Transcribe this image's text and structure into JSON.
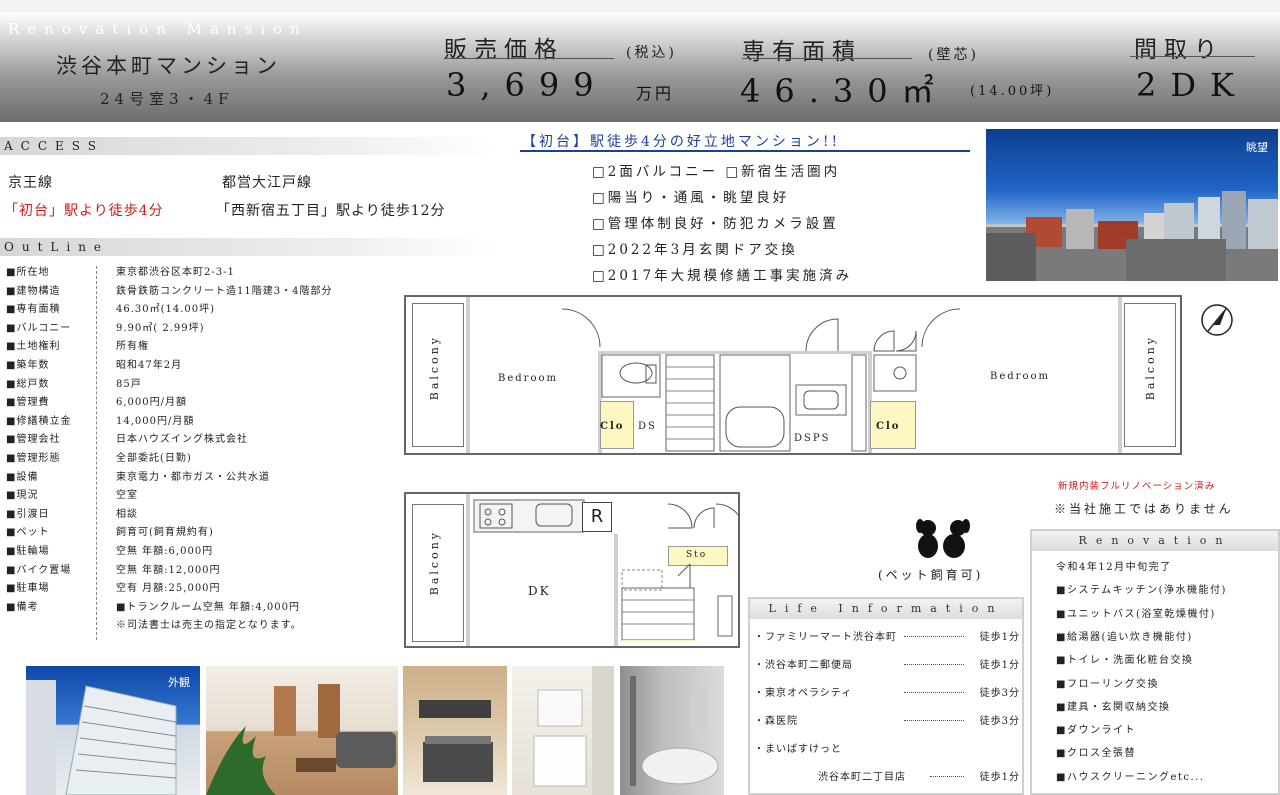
{
  "header": {
    "brand": "Renovation Mansion",
    "building_name": "渋谷本町マンション",
    "room": "24号室3・4F",
    "price_label": "販売価格",
    "price_tax": "(税込)",
    "price_value": "3,699",
    "price_unit": "万円",
    "area_label": "専有面積",
    "area_note": "(壁芯)",
    "area_value": "46.30㎡",
    "area_tsubo": "(14.00坪)",
    "layout_label": "間取り",
    "layout_value": "2DK"
  },
  "access": {
    "title": "ACCESS",
    "line1_name": "京王線",
    "line1_station": "「初台」駅より徒歩4分",
    "line2_name": "都営大江戸線",
    "line2_station": "「西新宿五丁目」駅より徒歩12分"
  },
  "outline": {
    "title": "OutLine",
    "rows": [
      {
        "label": "■所在地",
        "value": "東京都渋谷区本町2-3-1"
      },
      {
        "label": "■建物構造",
        "value": "鉄骨鉄筋コンクリート造11階建3・4階部分"
      },
      {
        "label": "■専有面積",
        "value": "46.30㎡(14.00坪)"
      },
      {
        "label": "■バルコニー",
        "value": "9.90㎡( 2.99坪)"
      },
      {
        "label": "■土地権利",
        "value": "所有権"
      },
      {
        "label": "■築年数",
        "value": "昭和47年2月"
      },
      {
        "label": "■総戸数",
        "value": "85戸"
      },
      {
        "label": "■管理費",
        "value": "6,000円/月額"
      },
      {
        "label": "■修繕積立金",
        "value": "14,000円/月額"
      },
      {
        "label": "■管理会社",
        "value": "日本ハウズイング株式会社"
      },
      {
        "label": "■管理形態",
        "value": "全部委託(日勤)"
      },
      {
        "label": "■設備",
        "value": "東京電力・都市ガス・公共水道"
      },
      {
        "label": "■現況",
        "value": "空室"
      },
      {
        "label": "■引渡日",
        "value": "相談"
      },
      {
        "label": "■ペット",
        "value": "飼育可(飼育規約有)"
      },
      {
        "label": "■駐輪場",
        "value": "空無 年額:6,000円"
      },
      {
        "label": "■バイク置場",
        "value": "空無 年額:12,000円"
      },
      {
        "label": "■駐車場",
        "value": "空有 月額:25,000円"
      },
      {
        "label": "■備考",
        "value": "■トランクルーム空無 年額:4,000円"
      },
      {
        "label": "",
        "value": "※司法書士は売主の指定となります。"
      }
    ]
  },
  "promo": {
    "title": "【初台】駅徒歩4分の好立地マンション!!",
    "features": [
      "□2面バルコニー □新宿生活圏内",
      "□陽当り・通風・眺望良好",
      "□管理体制良好・防犯カメラ設置",
      "□2022年3月玄関ドア交換",
      "□2017年大規模修繕工事実施済み"
    ]
  },
  "view_photo": {
    "caption": "眺望"
  },
  "floorplan": {
    "bedroom_left": "Bedroom",
    "bedroom_right": "Bedroom",
    "balcony": "Balcony",
    "clo": "Clo",
    "ds": "DS",
    "dsps": "DSPS",
    "dk": "DK",
    "r": "R",
    "sto": "Sto"
  },
  "pet": {
    "label": "(ペット飼育可)"
  },
  "notes": {
    "reno_red": "新規内装フルリノベーション済み",
    "not_own": "※当社施工ではありません"
  },
  "life": {
    "title": "Life Information",
    "items": [
      {
        "name": "・ファミリーマート渋谷本町",
        "dist": "徒歩1分"
      },
      {
        "name": "・渋谷本町二郵便局",
        "dist": "徒歩1分"
      },
      {
        "name": "・東京オペラシティ",
        "dist": "徒歩3分"
      },
      {
        "name": "・森医院",
        "dist": "徒歩3分"
      },
      {
        "name": "・まいばすけっと",
        "dist": ""
      },
      {
        "name": "渋谷本町二丁目店",
        "dist": "徒歩1分"
      }
    ]
  },
  "renovation": {
    "title": "Renovation",
    "items": [
      "令和4年12月中旬完了",
      "■システムキッチン(浄水機能付)",
      "■ユニットバス(浴室乾燥機付)",
      "■給湯器(追い炊き機能付)",
      "■トイレ・洗面化粧台交換",
      "■フローリング交換",
      "■建具・玄関収納交換",
      "■ダウンライト",
      "■クロス全張替",
      "■ハウスクリーニングetc..."
    ]
  },
  "thumbs": {
    "exterior_caption": "外観"
  }
}
